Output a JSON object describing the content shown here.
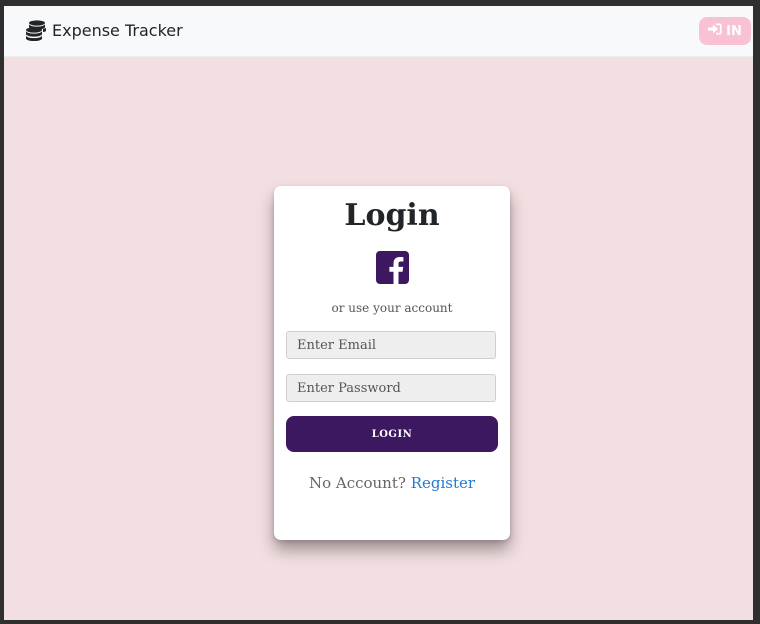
{
  "navbar": {
    "brand_name": "Expense Tracker",
    "brand_icon": "coins-icon",
    "login_nav_label": "IN",
    "login_nav_icon": "sign-in-icon"
  },
  "login_card": {
    "title": "Login",
    "social_icon": "facebook-icon",
    "alt_text": "or use your account",
    "email_placeholder": "Enter Email",
    "password_placeholder": "Enter Password",
    "submit_label": "LOGIN",
    "no_account_text": "No Account?",
    "register_label": "Register"
  },
  "colors": {
    "page_background": "#f3dfe1",
    "navbar_background": "#f8f9fa",
    "primary_button": "#3d1760",
    "facebook_icon": "#3d1760",
    "nav_button": "#f8c1d4",
    "link": "#1f7bd3"
  }
}
